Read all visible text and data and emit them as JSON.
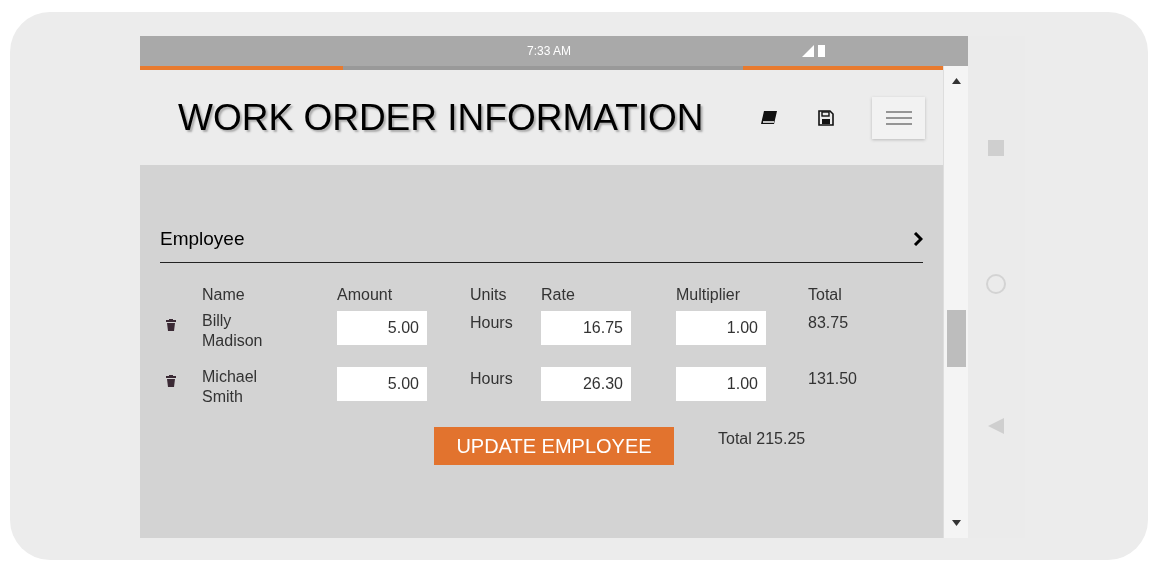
{
  "status_bar": {
    "time": "7:33 AM"
  },
  "loading": true,
  "header": {
    "title": "WORK ORDER INFORMATION"
  },
  "section": {
    "title": "Employee",
    "expanded": false
  },
  "table": {
    "columns": [
      "Name",
      "Amount",
      "Units",
      "Rate",
      "Multiplier",
      "Total"
    ],
    "rows": [
      {
        "name": "Billy Madison",
        "amount": "5.00",
        "units": "Hours",
        "rate": "16.75",
        "multiplier": "1.00",
        "total": "83.75"
      },
      {
        "name": "Michael Smith",
        "amount": "5.00",
        "units": "Hours",
        "rate": "26.30",
        "multiplier": "1.00",
        "total": "131.50"
      }
    ]
  },
  "update_button": "UPDATE EMPLOYEE",
  "grand_total": "Total 215.25"
}
